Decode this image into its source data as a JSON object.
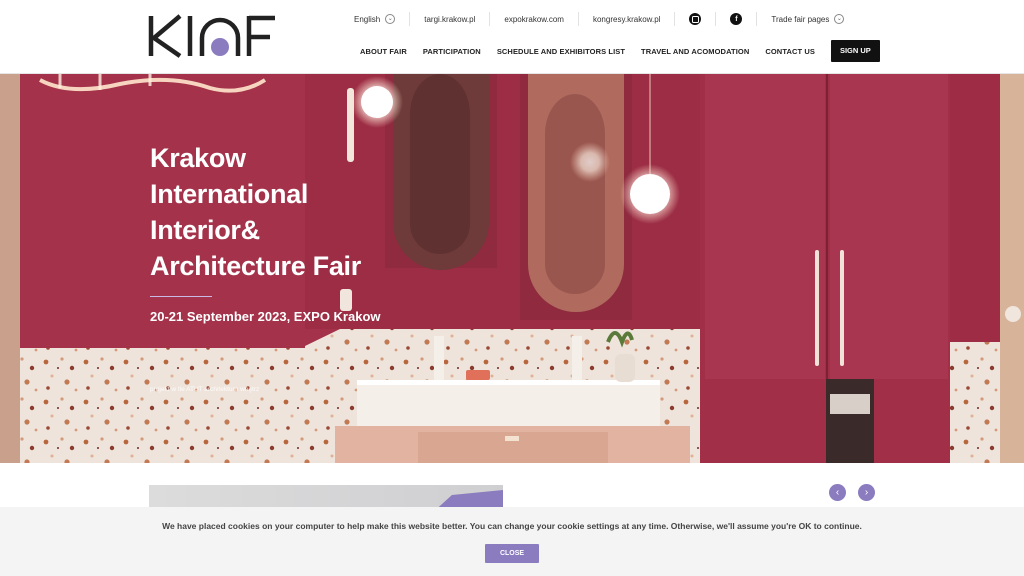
{
  "colors": {
    "accent": "#8b7bbf",
    "hero_red": "#a3324a",
    "dark": "#111111"
  },
  "logo": {
    "text": "KIAF"
  },
  "topbar": {
    "language": "English",
    "links": [
      "targi.krakow.pl",
      "expokrakow.com",
      "kongresy.krakow.pl"
    ],
    "social": [
      "instagram-icon",
      "facebook-icon"
    ],
    "trade_fair_pages": "Trade fair pages"
  },
  "nav": {
    "items": [
      "ABOUT FAIR",
      "PARTICIPATION",
      "SCHEDULE AND EXHIBITORS LIST",
      "TRAVEL AND ACOMODATION",
      "CONTACT US"
    ],
    "signup": "SIGN UP"
  },
  "hero": {
    "title_lines": [
      "Krakow",
      "International",
      "Interior&",
      "Architecture Fair"
    ],
    "date": "20-21 September 2023, EXPO Krakow",
    "credit": "projekt w tle ATUT architektura wnętrz"
  },
  "slider": {
    "prev": "‹",
    "next": "›"
  },
  "cookie": {
    "text": "We have placed cookies on your computer to help make this website better. You can change your cookie settings at any time. Otherwise, we'll assume you're OK to continue.",
    "close": "CLOSE"
  }
}
